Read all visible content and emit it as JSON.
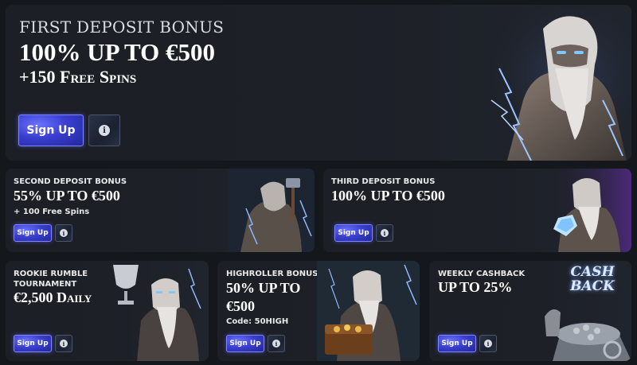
{
  "colors": {
    "background": "#14171c",
    "card": "#1d2027",
    "button": "#3a3fd0",
    "button_border": "#7f86ff",
    "lightning": "#8fb8ff"
  },
  "promos": [
    {
      "subtitle": "First Deposit Bonus",
      "title": "100% up to €500",
      "extra": "+150 Free Spins",
      "button": "Sign Up",
      "info_icon": "info-icon",
      "art": "thunder-god-lightning-image"
    },
    {
      "subtitle": "Second Deposit Bonus",
      "title": "55% up to €500",
      "extra": "+ 100 Free Spins",
      "button": "Sign Up",
      "info_icon": "info-icon",
      "art": "hammer-warrior-image"
    },
    {
      "subtitle": "Third Deposit Bonus",
      "title": "100% up to €500",
      "button": "Sign Up",
      "info_icon": "info-icon",
      "art": "god-with-diamonds-image"
    },
    {
      "subtitle": "Rookie Rumble Tournament",
      "title": "€2,500 Daily",
      "button": "Sign Up",
      "info_icon": "info-icon",
      "art": "god-with-trophy-image"
    },
    {
      "subtitle": "Highroller Bonus",
      "title": "50% up to €500",
      "extra": "Code: 50HIGH",
      "button": "Sign Up",
      "info_icon": "info-icon",
      "art": "god-with-treasure-chest-image"
    },
    {
      "subtitle": "Weekly Cashback",
      "title": "up to 25%",
      "button": "Sign Up",
      "info_icon": "info-icon",
      "art": "cash-back-cart-image",
      "art_text": "CASH BACK"
    }
  ]
}
